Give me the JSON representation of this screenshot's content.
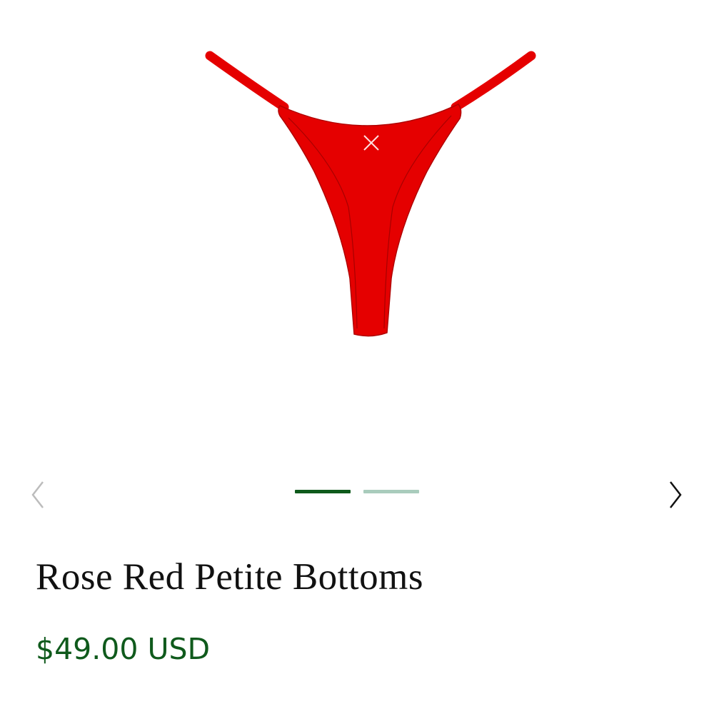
{
  "product": {
    "title": "Rose Red Petite Bottoms",
    "price": "$49.00 USD",
    "image": {
      "subject": "red-thong-bikini-bottom-icon",
      "fill_color": "#e50000",
      "logo_mark": "x-mark-icon"
    }
  },
  "gallery": {
    "prev_icon": "chevron-left-icon",
    "next_icon": "chevron-right-icon",
    "current_slide": 1,
    "total_slides": 2,
    "colors": {
      "active_dot": "#0e5a1b",
      "inactive_dot": "#a9ccbc",
      "prev_arrow": "#bcbcbc",
      "next_arrow": "#111111"
    }
  },
  "colors": {
    "title": "#111111",
    "price": "#0f5a1c"
  }
}
